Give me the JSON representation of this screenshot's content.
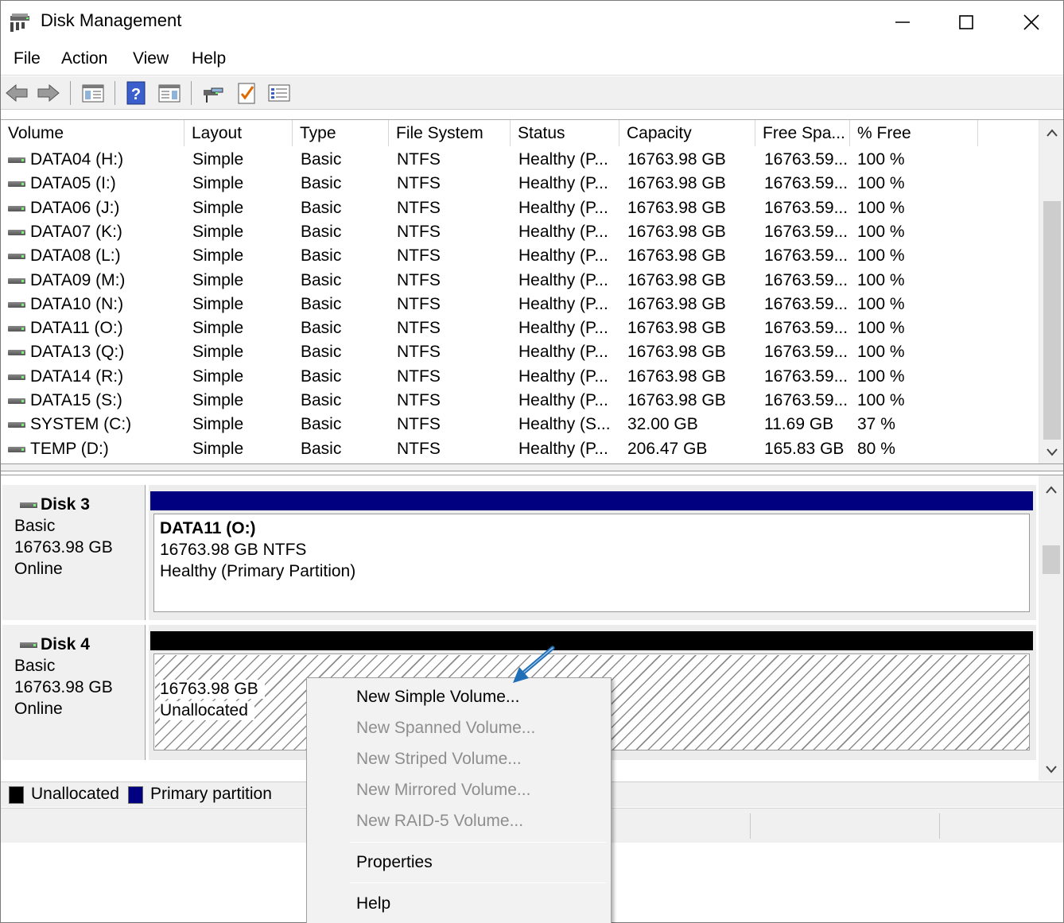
{
  "window": {
    "title": "Disk Management",
    "minimize_glyph": "—",
    "maximize_glyph": "☐",
    "close_glyph": "✕"
  },
  "menubar": {
    "items": [
      "File",
      "Action",
      "View",
      "Help"
    ]
  },
  "toolbar": {
    "buttons": [
      "back-icon",
      "forward-icon",
      "show-hide-console-tree-icon",
      "help-icon",
      "show-hide-action-pane-icon",
      "connect-icon",
      "checklist-icon",
      "properties-icon"
    ]
  },
  "volume_list": {
    "columns": [
      "Volume",
      "Layout",
      "Type",
      "File System",
      "Status",
      "Capacity",
      "Free Spa...",
      "% Free"
    ],
    "rows": [
      [
        "DATA04 (H:)",
        "Simple",
        "Basic",
        "NTFS",
        "Healthy (P...",
        "16763.98 GB",
        "16763.59...",
        "100 %"
      ],
      [
        "DATA05 (I:)",
        "Simple",
        "Basic",
        "NTFS",
        "Healthy (P...",
        "16763.98 GB",
        "16763.59...",
        "100 %"
      ],
      [
        "DATA06 (J:)",
        "Simple",
        "Basic",
        "NTFS",
        "Healthy (P...",
        "16763.98 GB",
        "16763.59...",
        "100 %"
      ],
      [
        "DATA07 (K:)",
        "Simple",
        "Basic",
        "NTFS",
        "Healthy (P...",
        "16763.98 GB",
        "16763.59...",
        "100 %"
      ],
      [
        "DATA08 (L:)",
        "Simple",
        "Basic",
        "NTFS",
        "Healthy (P...",
        "16763.98 GB",
        "16763.59...",
        "100 %"
      ],
      [
        "DATA09 (M:)",
        "Simple",
        "Basic",
        "NTFS",
        "Healthy (P...",
        "16763.98 GB",
        "16763.59...",
        "100 %"
      ],
      [
        "DATA10 (N:)",
        "Simple",
        "Basic",
        "NTFS",
        "Healthy (P...",
        "16763.98 GB",
        "16763.59...",
        "100 %"
      ],
      [
        "DATA11 (O:)",
        "Simple",
        "Basic",
        "NTFS",
        "Healthy (P...",
        "16763.98 GB",
        "16763.59...",
        "100 %"
      ],
      [
        "DATA13 (Q:)",
        "Simple",
        "Basic",
        "NTFS",
        "Healthy (P...",
        "16763.98 GB",
        "16763.59...",
        "100 %"
      ],
      [
        "DATA14 (R:)",
        "Simple",
        "Basic",
        "NTFS",
        "Healthy (P...",
        "16763.98 GB",
        "16763.59...",
        "100 %"
      ],
      [
        "DATA15 (S:)",
        "Simple",
        "Basic",
        "NTFS",
        "Healthy (P...",
        "16763.98 GB",
        "16763.59...",
        "100 %"
      ],
      [
        "SYSTEM (C:)",
        "Simple",
        "Basic",
        "NTFS",
        "Healthy (S...",
        "32.00 GB",
        "11.69 GB",
        "37 %"
      ],
      [
        "TEMP (D:)",
        "Simple",
        "Basic",
        "NTFS",
        "Healthy (P...",
        "206.47 GB",
        "165.83 GB",
        "80 %"
      ]
    ]
  },
  "disks": [
    {
      "name": "Disk 3",
      "type": "Basic",
      "size": "16763.98 GB",
      "state": "Online",
      "partition": {
        "title": "DATA11  (O:)",
        "size_fs": "16763.98 GB NTFS",
        "status": "Healthy (Primary Partition)",
        "bar_color": "#000080"
      }
    },
    {
      "name": "Disk 4",
      "type": "Basic",
      "size": "16763.98 GB",
      "state": "Online",
      "partition": {
        "size": "16763.98 GB",
        "status": "Unallocated",
        "bar_color": "#000000"
      }
    }
  ],
  "legend": {
    "items": [
      {
        "label": "Unallocated",
        "color": "#000000"
      },
      {
        "label": "Primary partition",
        "color": "#000080"
      }
    ]
  },
  "context_menu": {
    "items": [
      {
        "label": "New Simple Volume...",
        "enabled": true
      },
      {
        "label": "New Spanned Volume...",
        "enabled": false
      },
      {
        "label": "New Striped Volume...",
        "enabled": false
      },
      {
        "label": "New Mirrored Volume...",
        "enabled": false
      },
      {
        "label": "New RAID-5 Volume...",
        "enabled": false
      },
      {
        "label": "Properties",
        "enabled": true
      },
      {
        "label": "Help",
        "enabled": true
      }
    ]
  },
  "colors": {
    "annotation_arrow": "#1e6fb8",
    "primary_partition": "#000080",
    "unallocated": "#000000"
  }
}
